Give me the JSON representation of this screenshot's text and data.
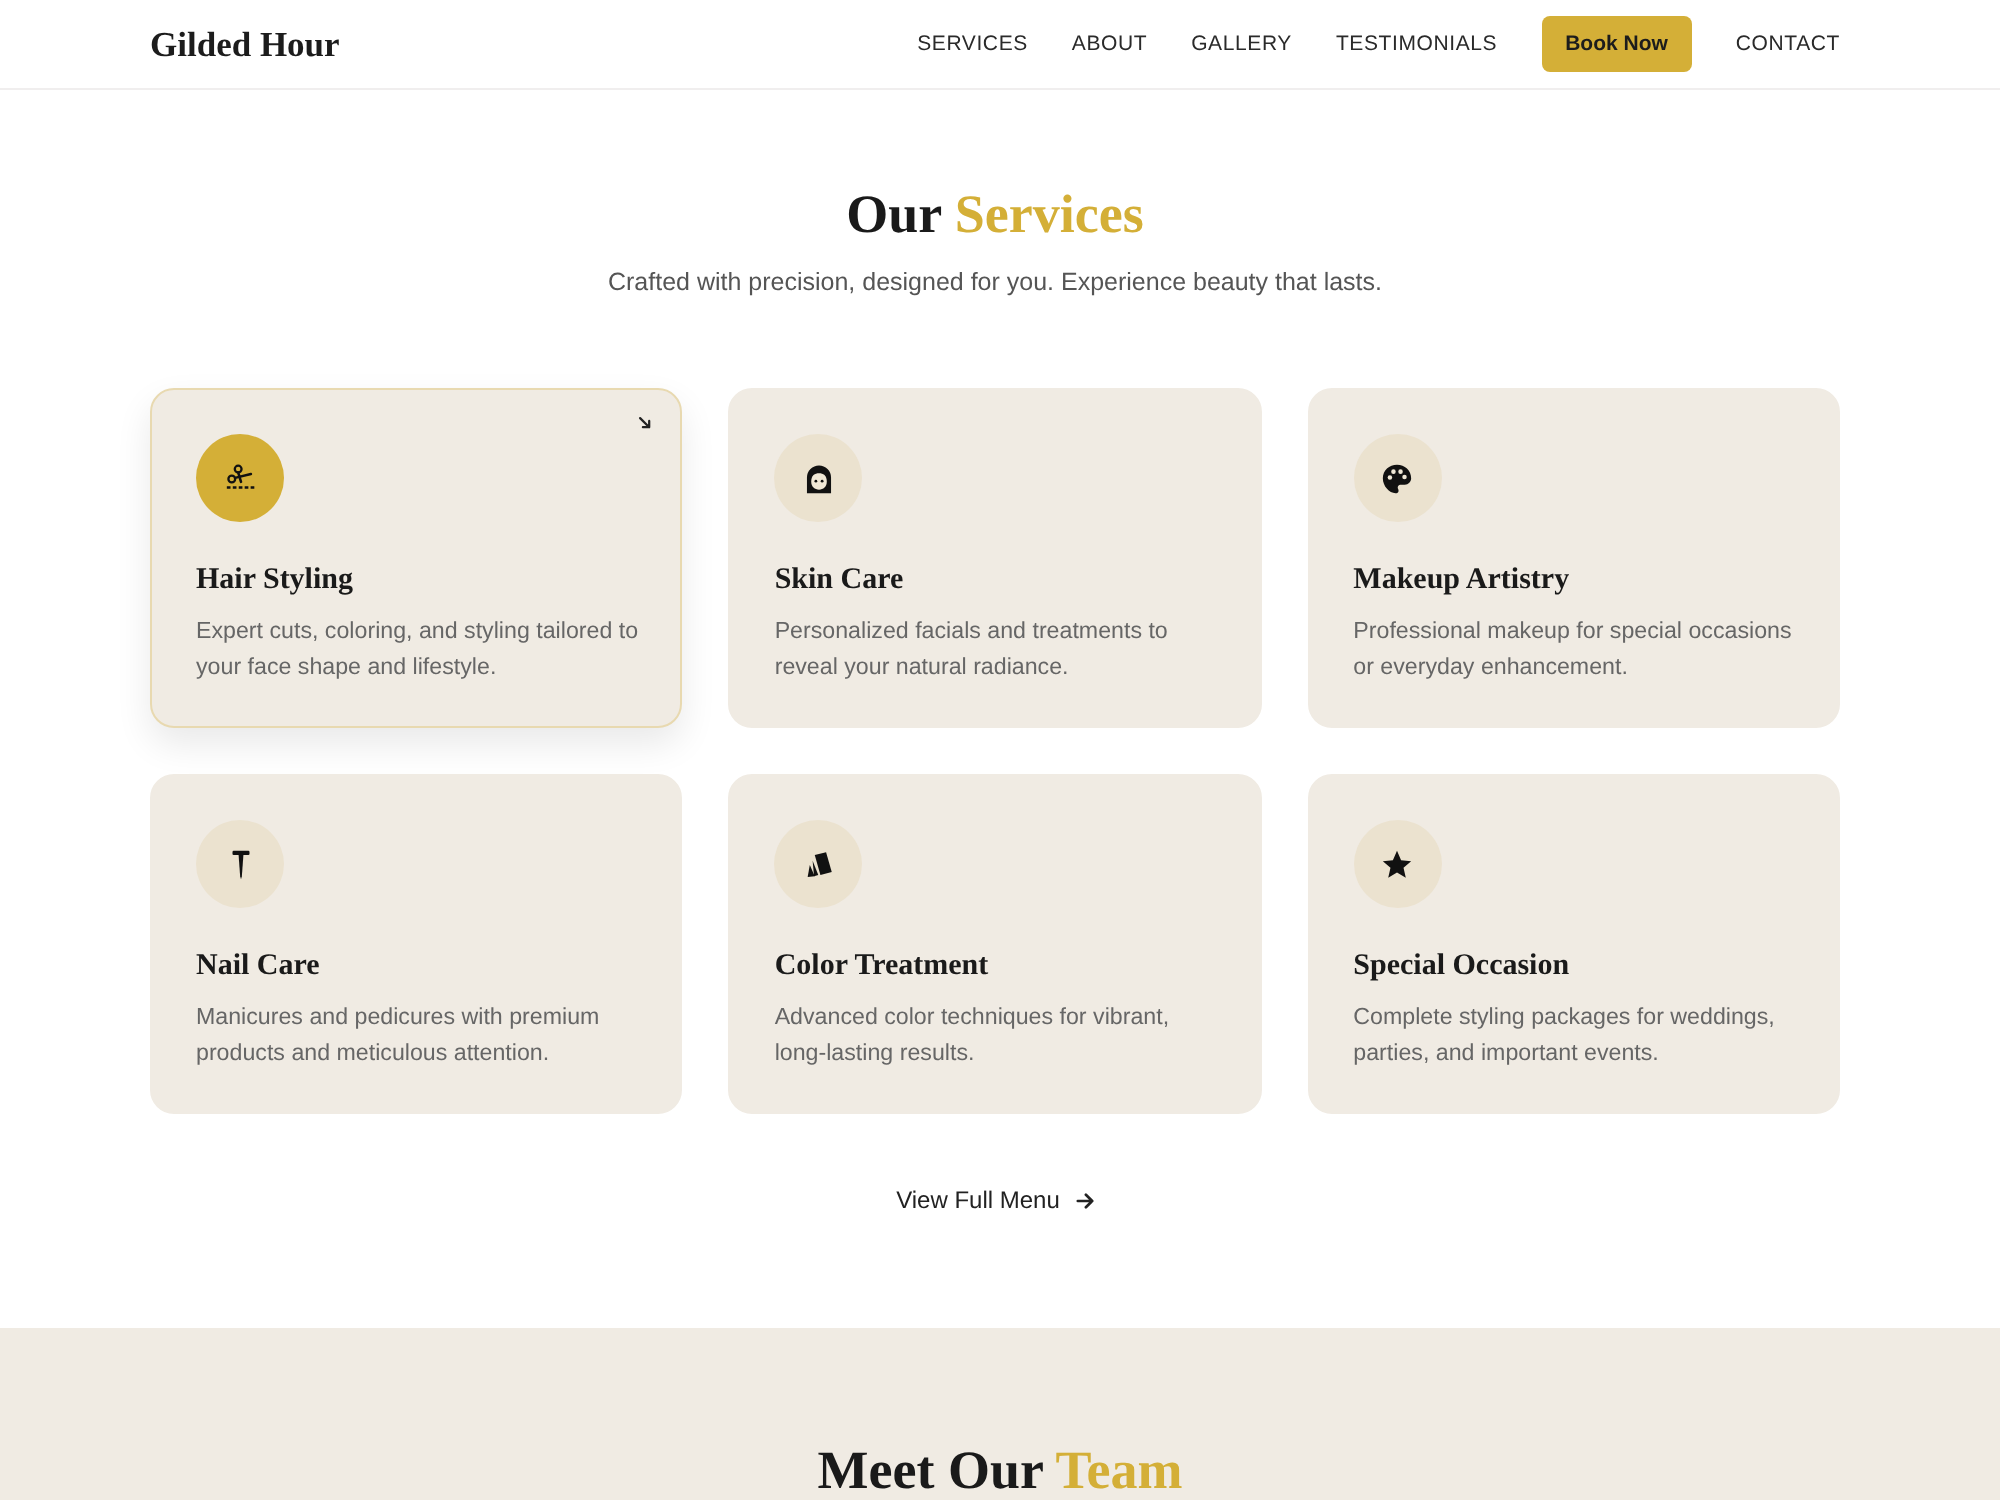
{
  "header": {
    "logo": "Gilded Hour",
    "nav": [
      {
        "label": "SERVICES",
        "kind": "link"
      },
      {
        "label": "ABOUT",
        "kind": "link"
      },
      {
        "label": "GALLERY",
        "kind": "link"
      },
      {
        "label": "TESTIMONIALS",
        "kind": "link"
      },
      {
        "label": "Book Now",
        "kind": "button"
      },
      {
        "label": "CONTACT",
        "kind": "link"
      }
    ]
  },
  "services": {
    "title": "Our",
    "title_accent": "Services",
    "subtitle": "Crafted with precision, designed for you. Experience beauty that lasts.",
    "cards": [
      {
        "title": "Hair Styling",
        "description": "Expert cuts, coloring, and styling tailored to your face shape and lifestyle.",
        "highlighted": true
      },
      {
        "title": "Skin Care",
        "description": "Personalized facials and treatments to reveal your natural radiance.",
        "highlighted": false
      },
      {
        "title": "Makeup Artistry",
        "description": "Professional makeup for special occasions or everyday enhancement.",
        "highlighted": false
      },
      {
        "title": "Nail Care",
        "description": "Manicures and pedicures with premium products and meticulous attention.",
        "highlighted": false
      },
      {
        "title": "Color Treatment",
        "description": "Advanced color techniques for vibrant, long-lasting results.",
        "highlighted": false
      },
      {
        "title": "Special Occasion",
        "description": "Complete styling packages for weddings, parties, and important events.",
        "highlighted": false
      }
    ],
    "link": "View Full Menu"
  },
  "team": {
    "title": "Meet Our",
    "title_accent": "Team"
  }
}
